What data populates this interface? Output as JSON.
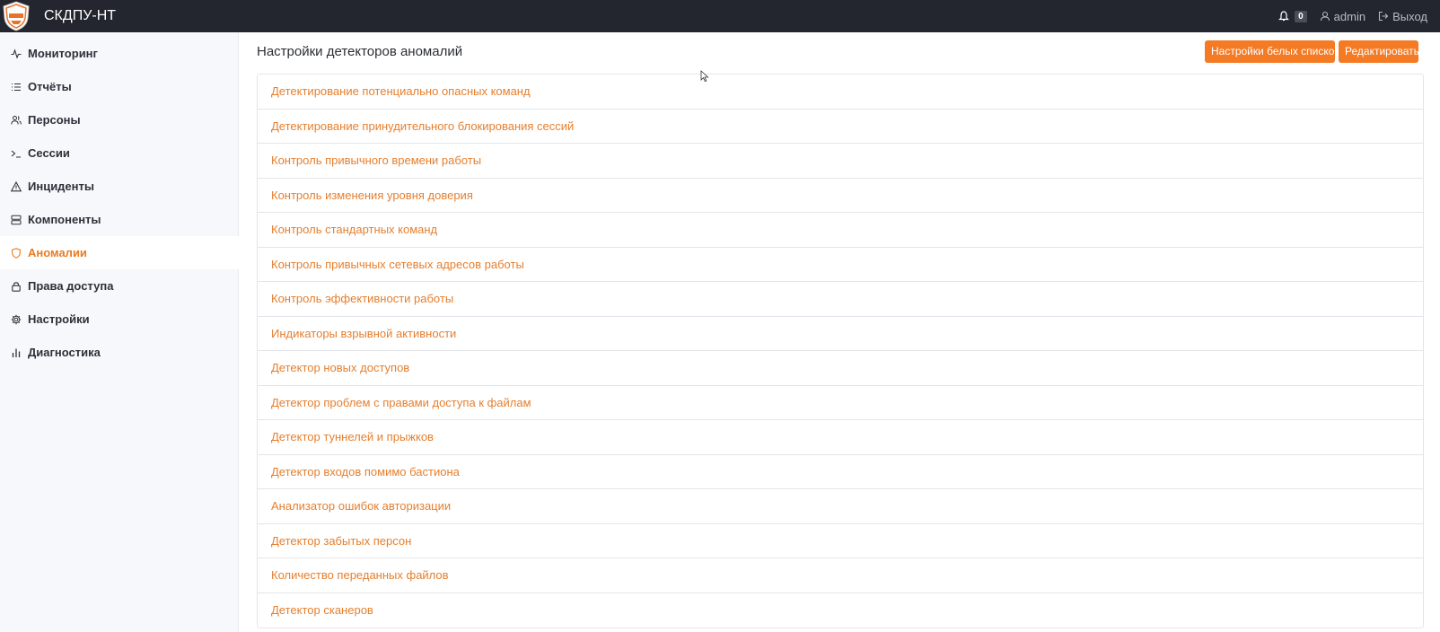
{
  "header": {
    "title": "СКДПУ-НТ",
    "notifications_count": "0",
    "user": "admin",
    "logout": "Выход"
  },
  "sidebar": {
    "items": [
      {
        "label": "Мониторинг",
        "icon": "activity-icon"
      },
      {
        "label": "Отчёты",
        "icon": "list-icon"
      },
      {
        "label": "Персоны",
        "icon": "users-icon"
      },
      {
        "label": "Сессии",
        "icon": "terminal-icon"
      },
      {
        "label": "Инциденты",
        "icon": "warning-icon"
      },
      {
        "label": "Компоненты",
        "icon": "server-icon"
      },
      {
        "label": "Аномалии",
        "icon": "shield-icon",
        "active": true
      },
      {
        "label": "Права доступа",
        "icon": "lock-icon"
      },
      {
        "label": "Настройки",
        "icon": "gear-icon"
      },
      {
        "label": "Диагностика",
        "icon": "bar-chart-icon"
      }
    ]
  },
  "main": {
    "title": "Настройки детекторов аномалий",
    "whitelist_button": "Настройки белых списков",
    "edit_button": "Редактировать",
    "detectors": [
      "Детектирование потенциально опасных команд",
      "Детектирование принудительного блокирования сессий",
      "Контроль привычного времени работы",
      "Контроль изменения уровня доверия",
      "Контроль стандартных команд",
      "Контроль привычных сетевых адресов работы",
      "Контроль эффективности работы",
      "Индикаторы взрывной активности",
      "Детектор новых доступов",
      "Детектор проблем с правами доступа к файлам",
      "Детектор туннелей и прыжков",
      "Детектор входов помимо бастиона",
      "Анализатор ошибок авторизации",
      "Детектор забытых персон",
      "Количество переданных файлов",
      "Детектор сканеров"
    ]
  },
  "colors": {
    "accent": "#f47a24",
    "link": "#e57f2e",
    "topbar": "#23252f",
    "sidebar": "#f7f8fc"
  }
}
